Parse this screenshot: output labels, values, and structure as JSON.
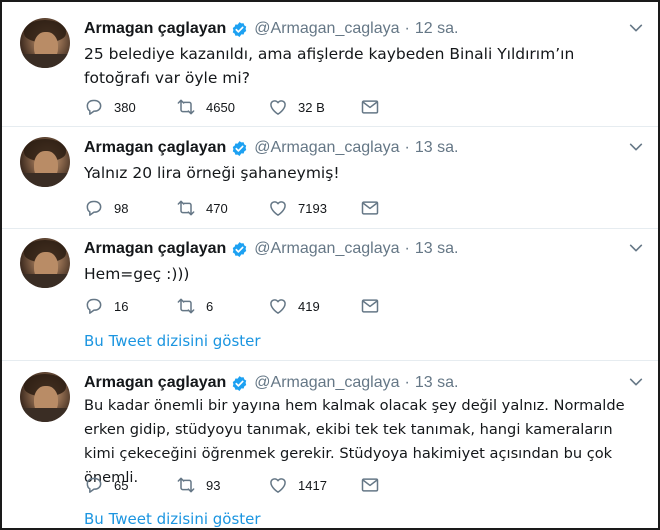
{
  "tweets": [
    {
      "name": "Armagan çaglayan",
      "handle": "@Armagan_caglaya",
      "dot": "·",
      "time": "12 sa.",
      "text": "25 belediye kazanıldı, ama afişlerde kaybeden Binali Yıldırım’ın fotoğrafı var öyle mi?",
      "reply": "380",
      "retweet": "4650",
      "like": "32 B"
    },
    {
      "name": "Armagan çaglayan",
      "handle": "@Armagan_caglaya",
      "dot": "·",
      "time": "13 sa.",
      "text": "Yalnız 20 lira örneği şahaneymiş!",
      "reply": "98",
      "retweet": "470",
      "like": "7193"
    },
    {
      "name": "Armagan çaglayan",
      "handle": "@Armagan_caglaya",
      "dot": "·",
      "time": "13 sa.",
      "text": "Hem=geç :)))",
      "reply": "16",
      "retweet": "6",
      "like": "419",
      "thread_link": "Bu Tweet dizisini göster"
    },
    {
      "name": "Armagan çaglayan",
      "handle": "@Armagan_caglaya",
      "dot": "·",
      "time": "13 sa.",
      "text": "Bu kadar önemli bir yayına hem kalmak olacak şey değil yalnız. Normalde erken gidip, stüdyoyu tanımak, ekibi tek tek tanımak, hangi kameraların kimi çekeceğini öğrenmek gerekir. Stüdyoya hakimiyet açısından bu çok önemli.",
      "reply": "65",
      "retweet": "93",
      "like": "1417",
      "thread_link": "Bu Tweet dizisini göster"
    }
  ],
  "colors": {
    "verified": "#1da1f2",
    "icon": "#657786",
    "link": "#1b95e0",
    "divider": "#e6ecf0"
  },
  "icons": [
    "reply-icon",
    "retweet-icon",
    "like-icon",
    "dm-icon",
    "verified-icon",
    "chevron-down-icon"
  ]
}
